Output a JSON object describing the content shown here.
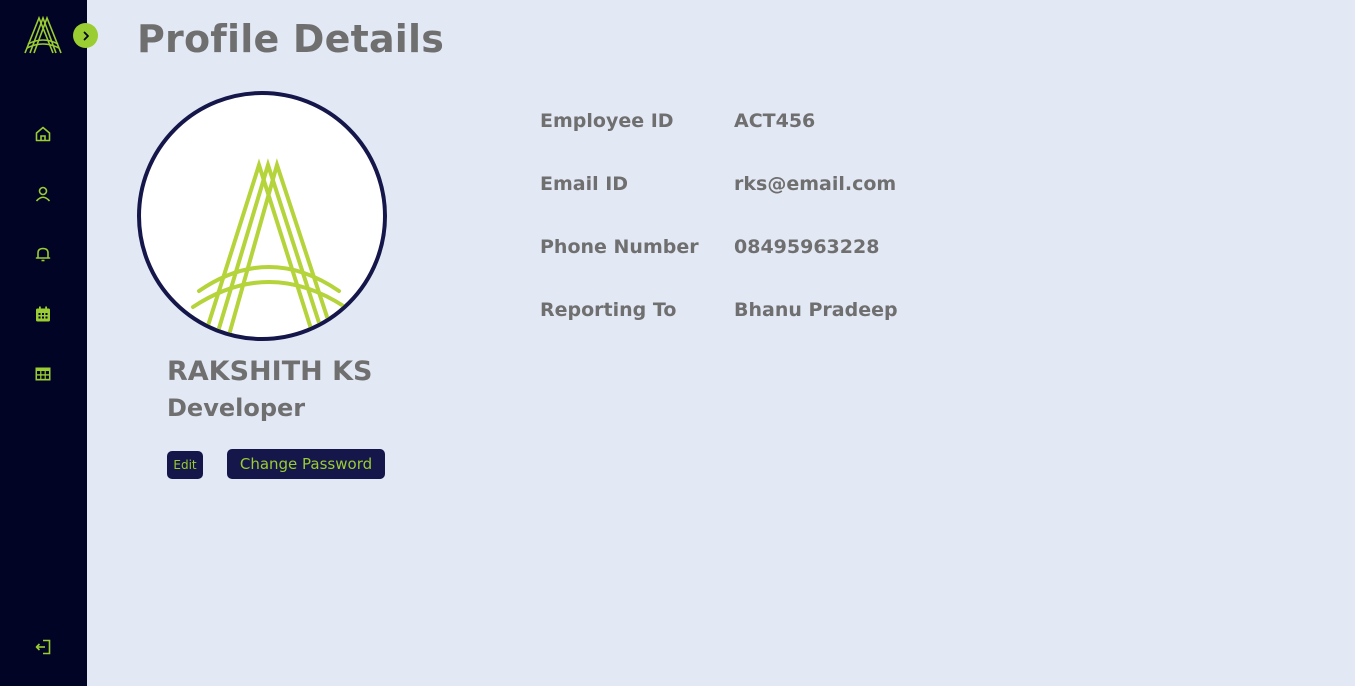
{
  "app": {
    "brand_color": "#9acd32",
    "sidebar_color": "#020426",
    "background_color": "#e3e8f5"
  },
  "sidebar": {
    "items": [
      {
        "name": "home",
        "icon": "home-icon"
      },
      {
        "name": "profile",
        "icon": "user-icon"
      },
      {
        "name": "notifications",
        "icon": "bell-icon"
      },
      {
        "name": "calendar",
        "icon": "calendar-icon"
      },
      {
        "name": "grid",
        "icon": "table-grid-icon"
      }
    ],
    "logout_icon": "logout-icon",
    "expand_icon": "chevron-right-icon"
  },
  "page": {
    "title": "Profile Details"
  },
  "profile": {
    "name": "RAKSHITH KS",
    "role": "Developer",
    "edit_label": "Edit",
    "change_password_label": "Change Password"
  },
  "details": [
    {
      "label": "Employee ID",
      "value": "ACT456"
    },
    {
      "label": "Email ID",
      "value": "rks@email.com"
    },
    {
      "label": "Phone Number",
      "value": "08495963228"
    },
    {
      "label": "Reporting To",
      "value": "Bhanu Pradeep"
    }
  ]
}
